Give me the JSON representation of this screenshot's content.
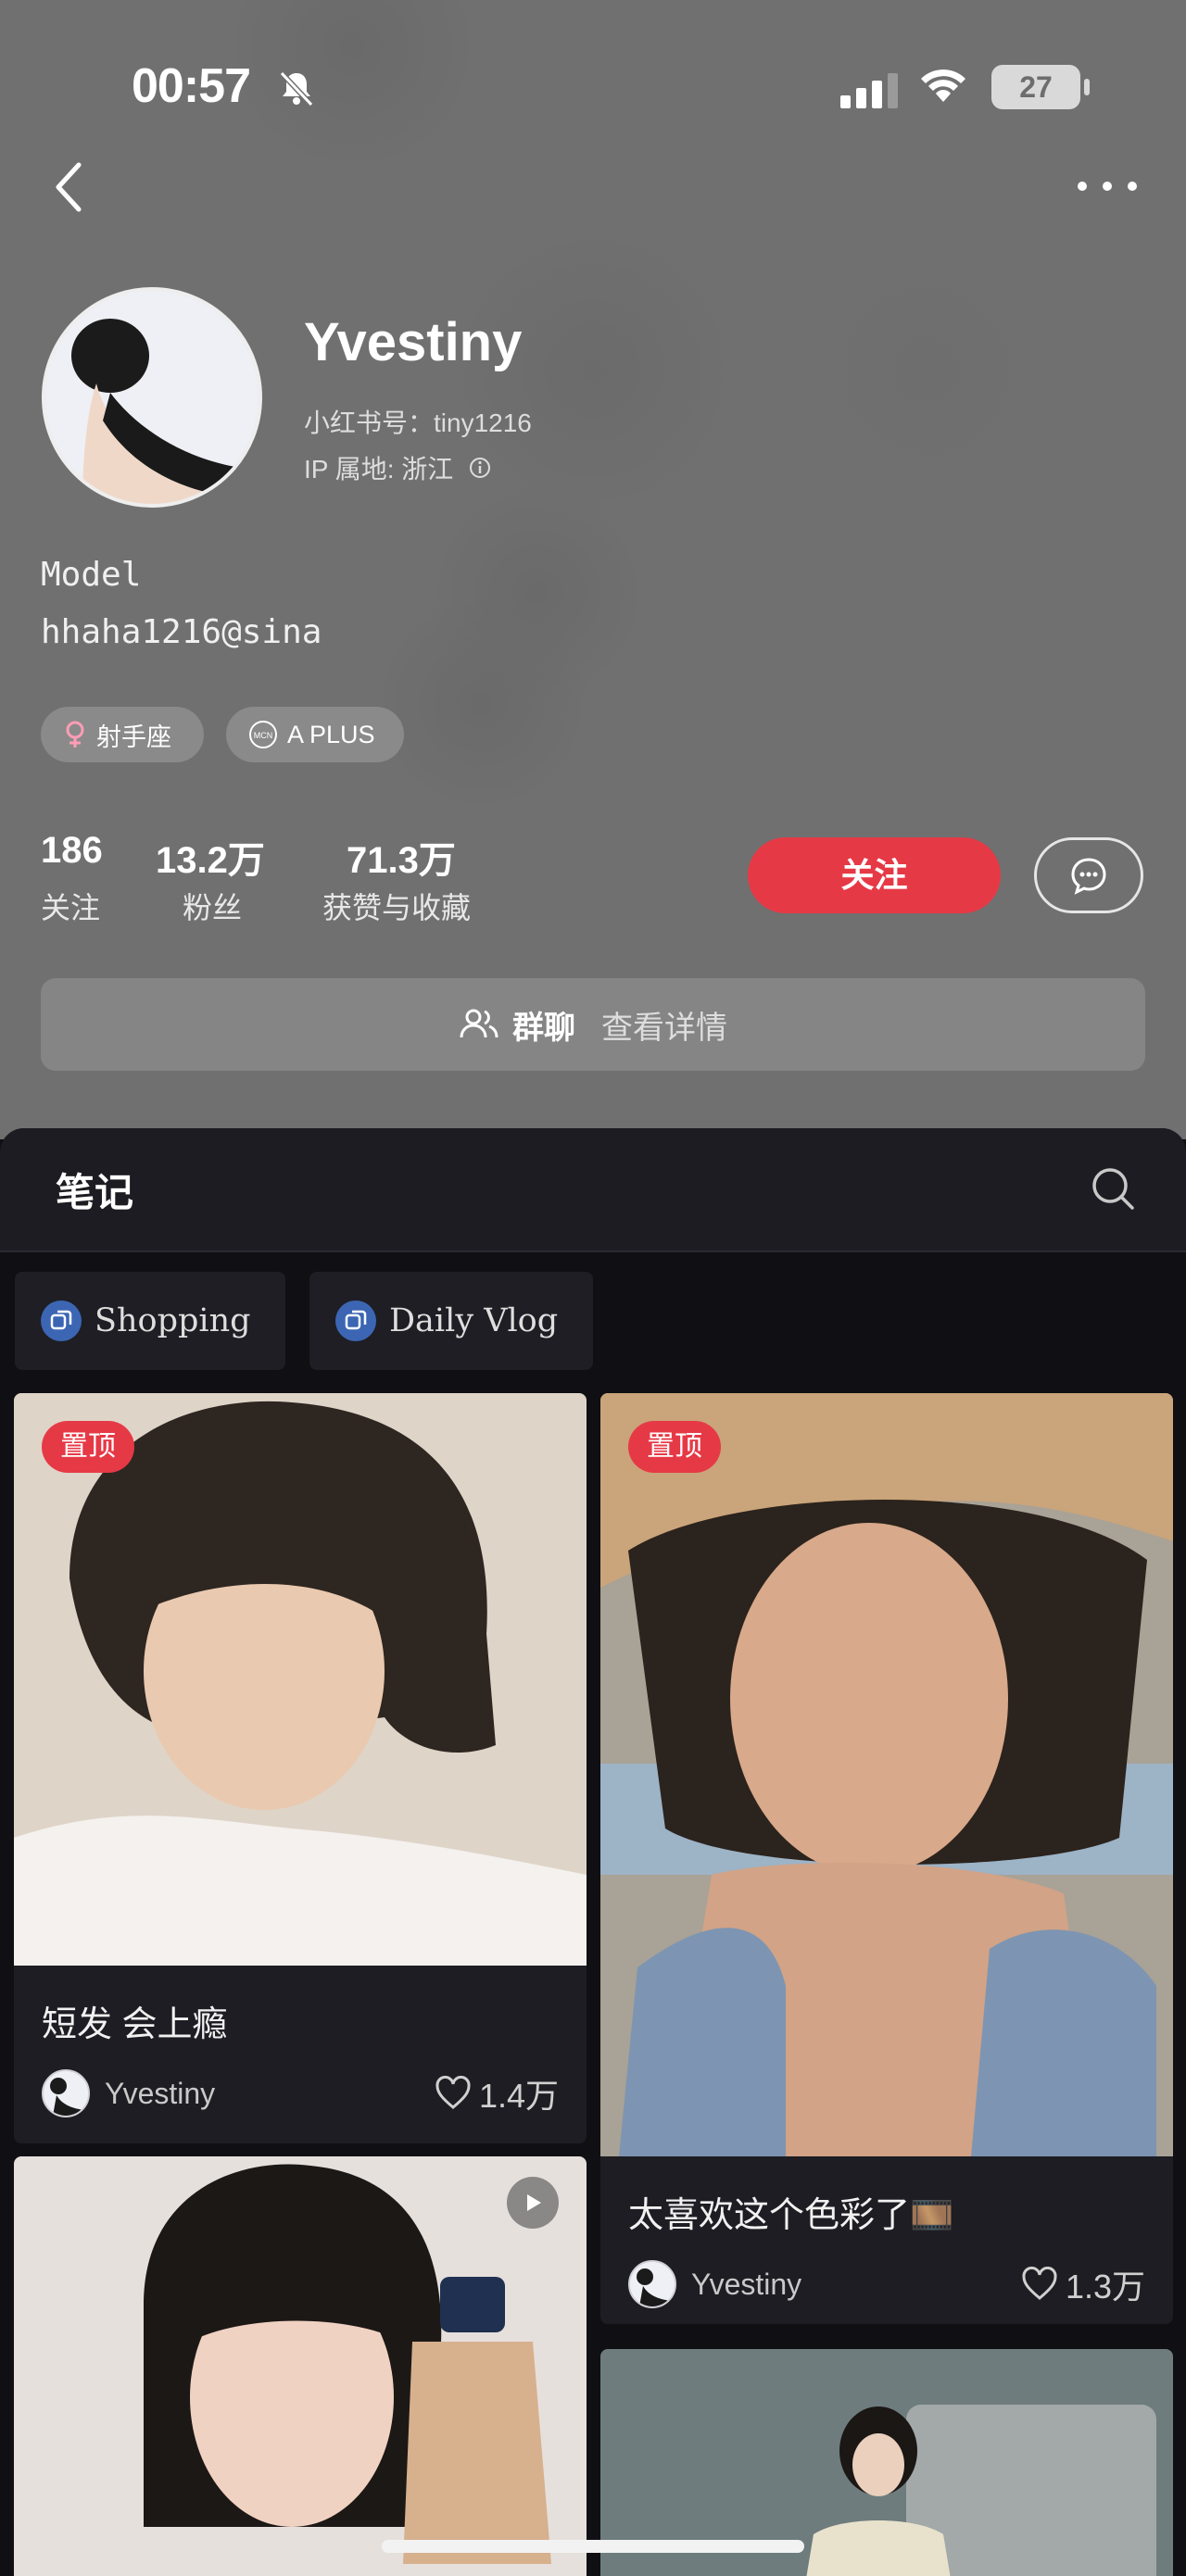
{
  "status_bar": {
    "time": "00:57",
    "battery": "27"
  },
  "profile": {
    "name": "Yvestiny",
    "id_line": "小红书号：tiny1216",
    "ip_line": "IP 属地: 浙江",
    "bio": [
      "Model",
      "hhaha1216@sina"
    ],
    "tags": [
      {
        "icon": "female-symbol-icon",
        "label": "射手座"
      },
      {
        "icon": "mcn-badge-icon",
        "label": "A PLUS"
      }
    ],
    "stats": [
      {
        "value": "186",
        "label": "关注"
      },
      {
        "value": "13.2万",
        "label": "粉丝"
      },
      {
        "value": "71.3万",
        "label": "获赞与收藏"
      }
    ],
    "follow_label": "关注",
    "group_chat": {
      "title": "群聊",
      "subtitle": "查看详情"
    }
  },
  "notes_section": {
    "title": "笔记",
    "collections": [
      "Shopping",
      "Daily Vlog"
    ],
    "cards": [
      {
        "pinned_label": "置顶",
        "title": "短发 会上瘾",
        "author": "Yvestiny",
        "likes": "1.4万"
      },
      {
        "pinned_label": "置顶",
        "title": "太喜欢这个色彩了🎞️",
        "author": "Yvestiny",
        "likes": "1.3万"
      },
      {
        "is_video": true
      }
    ]
  },
  "colors": {
    "accent_red": "#e63946",
    "header_gray": "#707070",
    "feed_bg": "#0f0f14",
    "card_bg": "#1d1d23"
  }
}
